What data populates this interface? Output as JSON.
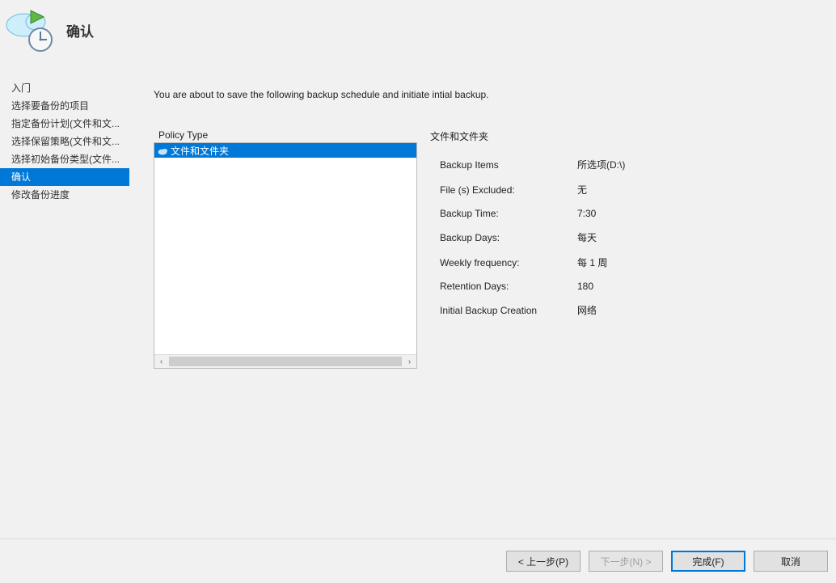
{
  "header": {
    "title": "确认"
  },
  "sidebar": {
    "items": [
      {
        "label": "入门"
      },
      {
        "label": "选择要备份的项目"
      },
      {
        "label": "指定备份计划(文件和文..."
      },
      {
        "label": "选择保留策略(文件和文..."
      },
      {
        "label": "选择初始备份类型(文件..."
      },
      {
        "label": "确认"
      },
      {
        "label": "修改备份进度"
      }
    ],
    "active_index": 5
  },
  "main": {
    "intro": "You are about to save the following backup schedule and initiate intial backup.",
    "policy_header": "Policy Type",
    "policy_items": [
      {
        "label": "文件和文件夹"
      }
    ],
    "details_title": "文件和文件夹",
    "details": [
      {
        "label": "Backup Items",
        "value": "所选项(D:\\)"
      },
      {
        "label": "File (s) Excluded:",
        "value": "无"
      },
      {
        "label": "Backup Time:",
        "value": "7:30"
      },
      {
        "label": "Backup Days:",
        "value": "每天"
      },
      {
        "label": "Weekly frequency:",
        "value": "每 1 周"
      },
      {
        "label": "Retention Days:",
        "value": "180"
      },
      {
        "label": "Initial Backup Creation",
        "value": "网络"
      }
    ]
  },
  "buttons": {
    "back": "< 上一步(P)",
    "next": "下一步(N) >",
    "finish": "完成(F)",
    "cancel": "取消"
  }
}
